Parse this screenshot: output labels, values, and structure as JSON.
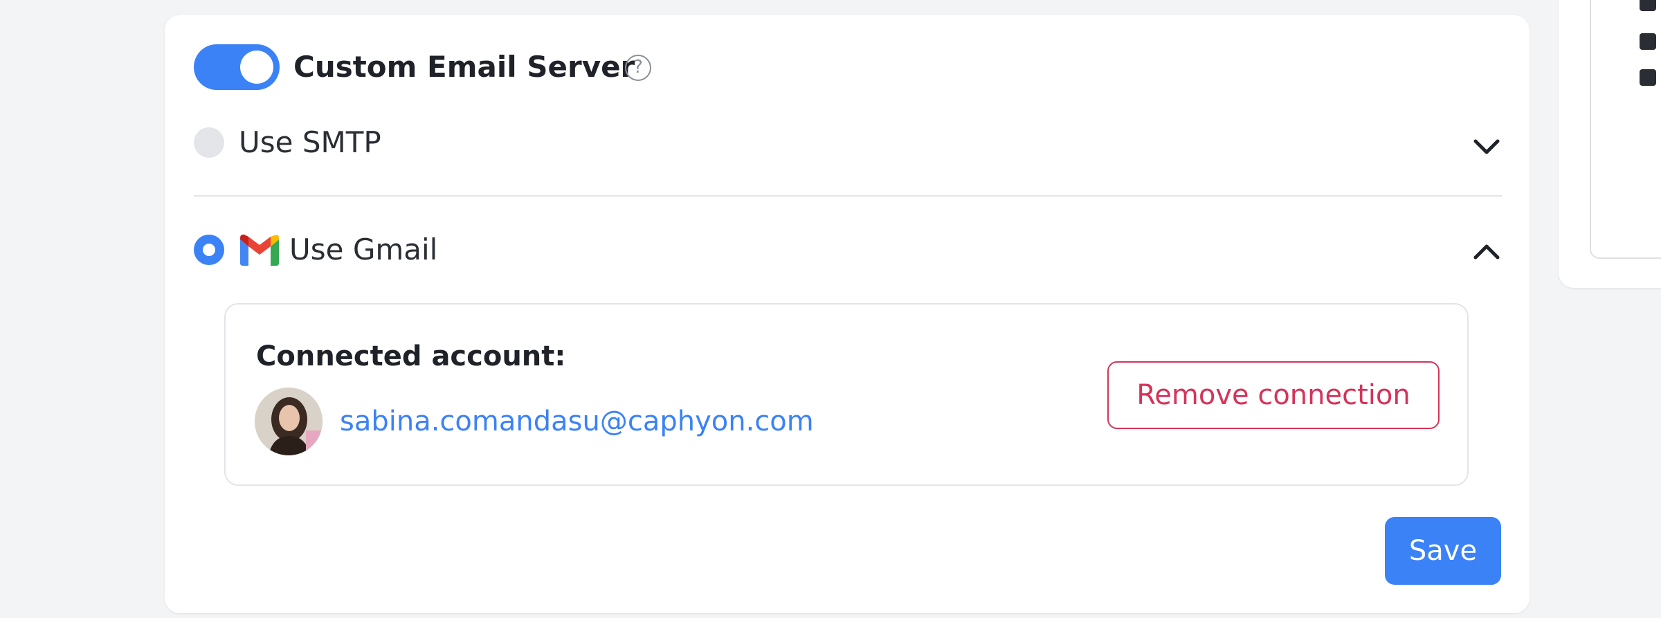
{
  "settings": {
    "toggle_enabled": true,
    "title": "Custom Email Server",
    "help_icon": "question-circle-icon",
    "options": {
      "smtp": {
        "label": "Use SMTP",
        "selected": false,
        "expanded": false
      },
      "gmail": {
        "label": "Use Gmail",
        "selected": true,
        "expanded": true,
        "icon": "gmail-icon"
      }
    },
    "connected": {
      "label": "Connected account:",
      "email": "sabina.comandasu@caphyon.com",
      "remove_label": "Remove connection"
    },
    "save_label": "Save"
  },
  "colors": {
    "accent": "#3b82f6",
    "danger": "#d6335a"
  }
}
